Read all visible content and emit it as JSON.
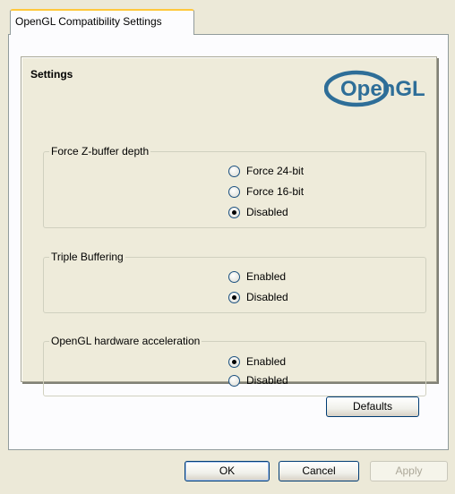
{
  "tab": {
    "label": "OpenGL Compatibility Settings"
  },
  "panel": {
    "heading": "Settings",
    "logo_text": "OpenGL"
  },
  "groups": {
    "zbuffer": {
      "legend": "Force Z-buffer depth",
      "options": [
        {
          "label": "Force 24-bit",
          "checked": false
        },
        {
          "label": "Force 16-bit",
          "checked": false
        },
        {
          "label": "Disabled",
          "checked": true
        }
      ]
    },
    "triple": {
      "legend": "Triple Buffering",
      "options": [
        {
          "label": "Enabled",
          "checked": false
        },
        {
          "label": "Disabled",
          "checked": true
        }
      ]
    },
    "hwaccel": {
      "legend": "OpenGL hardware acceleration",
      "options": [
        {
          "label": "Enabled",
          "checked": true
        },
        {
          "label": "Disabled",
          "checked": false
        }
      ]
    }
  },
  "buttons": {
    "defaults": "Defaults",
    "ok": "OK",
    "cancel": "Cancel",
    "apply": "Apply"
  },
  "colors": {
    "window_bg": "#ECE9D8",
    "logo_blue": "#2E6E98",
    "button_border": "#003C74"
  }
}
